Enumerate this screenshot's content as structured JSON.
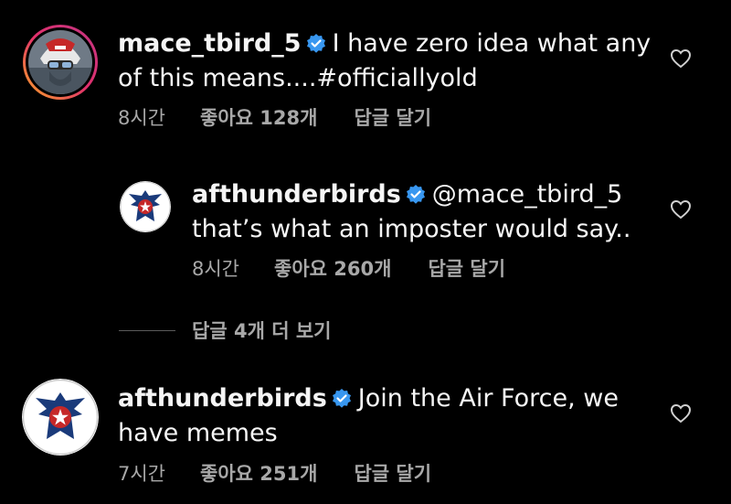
{
  "comments": [
    {
      "username": "mace_tbird_5",
      "text": "I have zero idea what any of this means....#officiallyold",
      "time": "8시간",
      "likes": "좋아요 128개",
      "reply": "답글 달기"
    },
    {
      "username": "afthunderbirds",
      "text": "@mace_tbird_5 that’s what an imposter would say..",
      "time": "8시간",
      "likes": "좋아요 260개",
      "reply": "답글 달기"
    },
    {
      "username": "afthunderbirds",
      "text": "Join the Air Force, we have memes",
      "time": "7시간",
      "likes": "좋아요 251개",
      "reply": "답글 달기"
    }
  ],
  "view_replies": "답글 4개 더 보기",
  "colors": {
    "background": "#000000",
    "verified": "#3897f0",
    "muted": "#a8a8a8",
    "story_ring_start": "#f9a825",
    "story_ring_end": "#d6249f"
  },
  "icons": {
    "verified": "verified-badge-icon",
    "like": "heart-outline-icon"
  }
}
